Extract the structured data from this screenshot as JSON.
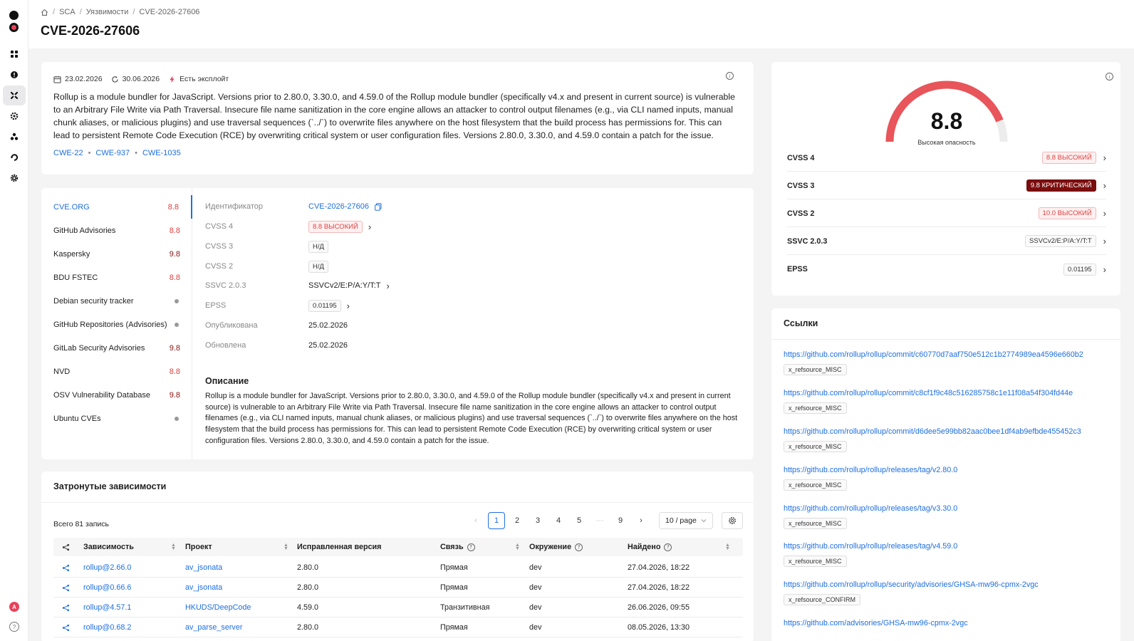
{
  "breadcrumb": [
    "SCA",
    "Уязвимости",
    "CVE-2026-27606"
  ],
  "page_title": "CVE-2026-27606",
  "summary": {
    "published": "23.02.2026",
    "updated": "30.06.2026",
    "exploit": "Есть эксплойт",
    "description": "Rollup is a module bundler for JavaScript. Versions prior to 2.80.0, 3.30.0, and 4.59.0 of the Rollup module bundler (specifically v4.x and present in current source) is vulnerable to an Arbitrary File Write via Path Traversal. Insecure file name sanitization in the core engine allows an attacker to control output filenames (e.g., via CLI named inputs, manual chunk aliases, or malicious plugins) and use traversal sequences (`../`) to overwrite files anywhere on the host filesystem that the build process has permissions for. This can lead to persistent Remote Code Execution (RCE) by overwriting critical system or user configuration files. Versions 2.80.0, 3.30.0, and 4.59.0 contain a patch for the issue.",
    "cwes": [
      "CWE-22",
      "CWE-937",
      "CWE-1035"
    ]
  },
  "sources": [
    {
      "name": "CVE.ORG",
      "score": "8.8",
      "level": "high"
    },
    {
      "name": "GitHub Advisories",
      "score": "8.8",
      "level": "high"
    },
    {
      "name": "Kaspersky",
      "score": "9.8",
      "level": "critical"
    },
    {
      "name": "BDU FSTEC",
      "score": "8.8",
      "level": "high"
    },
    {
      "name": "Debian security tracker",
      "score": "",
      "level": "none"
    },
    {
      "name": "GitHub Repositories (Advisories)",
      "score": "",
      "level": "none"
    },
    {
      "name": "GitLab Security Advisories",
      "score": "9.8",
      "level": "critical"
    },
    {
      "name": "NVD",
      "score": "8.8",
      "level": "high"
    },
    {
      "name": "OSV Vulnerability Database",
      "score": "9.8",
      "level": "critical"
    },
    {
      "name": "Ubuntu CVEs",
      "score": "",
      "level": "none"
    }
  ],
  "details": {
    "id_label": "Идентификатор",
    "id_value": "CVE-2026-27606",
    "cvss4_label": "CVSS 4",
    "cvss4_value": "8.8 ВЫСОКИЙ",
    "cvss3_label": "CVSS 3",
    "cvss3_value": "Н/Д",
    "cvss2_label": "CVSS 2",
    "cvss2_value": "Н/Д",
    "ssvc_label": "SSVC 2.0.3",
    "ssvc_value": "SSVCv2/E:P/A:Y/T:T",
    "epss_label": "EPSS",
    "epss_value": "0.01195",
    "published_label": "Опубликована",
    "published_value": "25.02.2026",
    "updated_label": "Обновлена",
    "updated_value": "25.02.2026",
    "desc_title": "Описание",
    "description": "Rollup is a module bundler for JavaScript. Versions prior to 2.80.0, 3.30.0, and 4.59.0 of the Rollup module bundler (specifically v4.x and present in current source) is vulnerable to an Arbitrary File Write via Path Traversal. Insecure file name sanitization in the core engine allows an attacker to control output filenames (e.g., via CLI named inputs, manual chunk aliases, or malicious plugins) and use traversal sequences (`../`) to overwrite files anywhere on the host filesystem that the build process has permissions for. This can lead to persistent Remote Code Execution (RCE) by overwriting critical system or user configuration files. Versions 2.80.0, 3.30.0, and 4.59.0 contain a patch for the issue."
  },
  "deps": {
    "title": "Затронутые зависимости",
    "total": "Всего 81 запись",
    "pages": [
      "1",
      "2",
      "3",
      "4",
      "5",
      "···",
      "9"
    ],
    "page_size": "10 / page",
    "columns": [
      "Зависимость",
      "Проект",
      "Исправленная версия",
      "Связь",
      "Окружение",
      "Найдено"
    ],
    "rows": [
      [
        "rollup@2.66.0",
        "av_jsonata",
        "2.80.0",
        "Прямая",
        "dev",
        "27.04.2026, 18:22"
      ],
      [
        "rollup@0.66.6",
        "av_jsonata",
        "2.80.0",
        "Прямая",
        "dev",
        "27.04.2026, 18:22"
      ],
      [
        "rollup@4.57.1",
        "HKUDS/DeepCode",
        "4.59.0",
        "Транзитивная",
        "dev",
        "26.06.2026, 09:55"
      ],
      [
        "rollup@0.68.2",
        "av_parse_server",
        "2.80.0",
        "Прямая",
        "dev",
        "08.05.2026, 13:30"
      ]
    ]
  },
  "gauge": {
    "score": "8.8",
    "fraction": 0.88,
    "label": "Высокая опасность",
    "color": "#e8555a"
  },
  "scores": [
    {
      "label": "CVSS 4",
      "value": "8.8 ВЫСОКИЙ",
      "style": "red"
    },
    {
      "label": "CVSS 3",
      "value": "9.8 КРИТИЧЕСКИЙ",
      "style": "dark"
    },
    {
      "label": "CVSS 2",
      "value": "10.0 ВЫСОКИЙ",
      "style": "red"
    },
    {
      "label": "SSVC 2.0.3",
      "value": "SSVCv2/E:P/A:Y/T:T",
      "style": "plain"
    },
    {
      "label": "EPSS",
      "value": "0.01195",
      "style": "plain"
    }
  ],
  "links": {
    "title": "Ссылки",
    "items": [
      {
        "url": "https://github.com/rollup/rollup/commit/c60770d7aaf750e512c1b2774989ea4596e660b2",
        "tag": "x_refsource_MISC"
      },
      {
        "url": "https://github.com/rollup/rollup/commit/c8cf1f9c48c516285758c1e11f08a54f304fd44e",
        "tag": "x_refsource_MISC"
      },
      {
        "url": "https://github.com/rollup/rollup/commit/d6dee5e99bb82aac0bee1df4ab9efbde455452c3",
        "tag": "x_refsource_MISC"
      },
      {
        "url": "https://github.com/rollup/rollup/releases/tag/v2.80.0",
        "tag": "x_refsource_MISC"
      },
      {
        "url": "https://github.com/rollup/rollup/releases/tag/v3.30.0",
        "tag": "x_refsource_MISC"
      },
      {
        "url": "https://github.com/rollup/rollup/releases/tag/v4.59.0",
        "tag": "x_refsource_MISC"
      },
      {
        "url": "https://github.com/rollup/rollup/security/advisories/GHSA-mw96-cpmx-2vgc",
        "tag": "x_refsource_CONFIRM"
      },
      {
        "url": "https://github.com/advisories/GHSA-mw96-cpmx-2vgc",
        "tag": ""
      }
    ]
  },
  "user": {
    "avatar_letter": "A"
  },
  "help": {
    "symbol": "?"
  }
}
